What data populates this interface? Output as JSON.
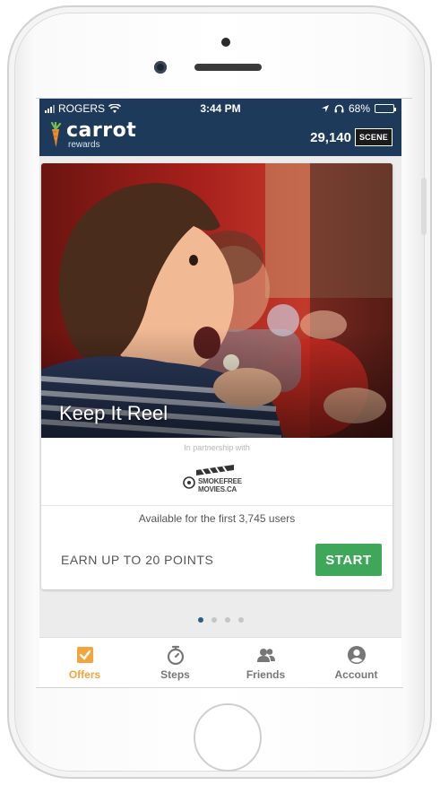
{
  "status_bar": {
    "carrier": "ROGERS",
    "time": "3:44 PM",
    "battery": "68%",
    "battery_level": 0.68
  },
  "app_bar": {
    "logo_title": "carrot",
    "logo_subtitle": "rewards",
    "points": "29,140",
    "partner_badge": "SCENE"
  },
  "offer_card": {
    "title": "Keep It Reel",
    "partnership_label": "In partnership with",
    "partner_logo_text": [
      "SMOKEFREE",
      "MOVIES.CA"
    ],
    "availability": "Available for the first 3,745 users",
    "earn_text": "EARN UP TO 20 POINTS",
    "start_label": "START"
  },
  "carousel": {
    "count": 4,
    "active_index": 0
  },
  "tabs": [
    {
      "label": "Offers",
      "icon": "check-square-icon",
      "active": true
    },
    {
      "label": "Steps",
      "icon": "stopwatch-icon",
      "active": false
    },
    {
      "label": "Friends",
      "icon": "friends-icon",
      "active": false
    },
    {
      "label": "Account",
      "icon": "account-icon",
      "active": false
    }
  ],
  "colors": {
    "header": "#1e3a5a",
    "accent": "#f4a43a",
    "start_button": "#3fa75a",
    "dot_active": "#2f5d8a"
  }
}
